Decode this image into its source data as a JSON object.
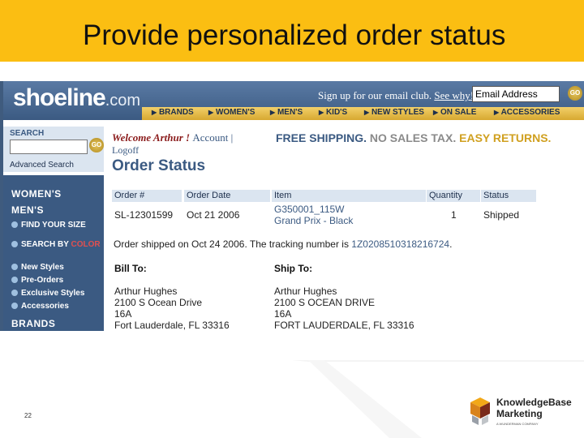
{
  "slide": {
    "title": "Provide personalized order status",
    "page_number": "22"
  },
  "site": {
    "logo_main": "shoeline",
    "logo_suffix": ".com",
    "signup_text": "Sign up for our email club.",
    "signup_link": "See why!",
    "email_value": "Email Address",
    "go_label": "GO",
    "nav": [
      "BRANDS",
      "WOMEN'S",
      "MEN'S",
      "KID'S",
      "NEW STYLES",
      "ON SALE",
      "ACCESSORIES"
    ]
  },
  "sidebar": {
    "search_label": "SEARCH",
    "go_label": "GO",
    "advanced": "Advanced Search",
    "heading_women": "WOMEN'S",
    "heading_men": "MEN'S",
    "find_size": "FIND YOUR SIZE",
    "search_by": "SEARCH BY",
    "color_word": "COLOR",
    "items": [
      "New Styles",
      "Pre-Orders",
      "Exclusive Styles",
      "Accessories"
    ],
    "heading_brands": "BRANDS"
  },
  "account": {
    "welcome": "Welcome Arthur !",
    "account_link": "Account",
    "separator": "|",
    "logoff": "Logoff"
  },
  "promo": {
    "part1": "FREE SHIPPING.",
    "part2": "NO SALES TAX.",
    "part3": "EASY RETURNS."
  },
  "order": {
    "title": "Order Status",
    "headers": [
      "Order #",
      "Order Date",
      "Item",
      "Quantity",
      "Status"
    ],
    "row": {
      "order_no": "SL-12301599",
      "date": "Oct 21 2006",
      "item_code": "G350001_115W",
      "item_name": "Grand Prix - Black",
      "quantity": "1",
      "status": "Shipped"
    },
    "shipped_text": "Order shipped on Oct 24 2006. The tracking number is",
    "tracking": "1Z0208510318216724",
    "period": ".",
    "bill_to_label": "Bill To:",
    "ship_to_label": "Ship To:",
    "bill_to": [
      "Arthur Hughes",
      "2100 S Ocean Drive",
      "16A",
      "Fort Lauderdale, FL 33316"
    ],
    "ship_to": [
      "Arthur Hughes",
      "2100 S OCEAN DRIVE",
      "16A",
      "FORT LAUDERDALE, FL 33316"
    ]
  },
  "brand_logo": {
    "line1": "KnowledgeBase",
    "line2": "Marketing",
    "sub": "A WUNDERMAN COMPANY"
  }
}
